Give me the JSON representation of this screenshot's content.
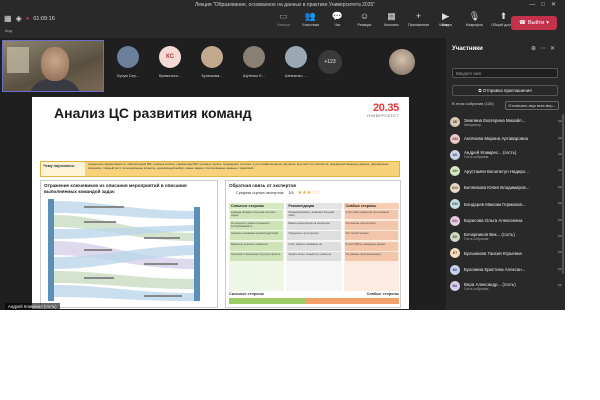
{
  "window": {
    "title": "Лекция \"Образование, основанное на данных в практике Университета 2035\"",
    "controls": [
      "—",
      "□",
      "✕"
    ]
  },
  "toolbar": {
    "exit_label": "Код",
    "timer": "01:09:16",
    "buttons": [
      {
        "icon": "video-icon",
        "glyph": "▭",
        "label": "Камера",
        "dim": true
      },
      {
        "icon": "participants-icon",
        "glyph": "👥",
        "label": "Участники",
        "dim": false
      },
      {
        "icon": "chat-icon",
        "glyph": "💬",
        "label": "Чат",
        "dim": false
      },
      {
        "icon": "reactions-icon",
        "glyph": "☺",
        "label": "Реакции",
        "dim": false
      },
      {
        "icon": "rooms-icon",
        "glyph": "▦",
        "label": "Комнаты",
        "dim": false
      },
      {
        "icon": "apps-icon",
        "glyph": "+",
        "label": "Приложения",
        "dim": false
      },
      {
        "icon": "more-icon",
        "glyph": "···",
        "label": "Еще",
        "dim": false
      }
    ],
    "right_buttons": [
      {
        "icon": "camera-icon",
        "glyph": "▶",
        "label": "Камера"
      },
      {
        "icon": "mic-icon",
        "glyph": "🎙",
        "label": "Микрофон"
      },
      {
        "icon": "share-icon",
        "glyph": "⬆",
        "label": "Общий доступ"
      }
    ],
    "leave_label": "Выйти"
  },
  "tiles": [
    {
      "initials": "",
      "name": "Кучум Сер...",
      "bg": "#6b7f9a",
      "fg": "#fff"
    },
    {
      "initials": "КС",
      "name": "Кривоносо...",
      "bg": "#f4d9d4",
      "fg": "#a1443a"
    },
    {
      "initials": "",
      "name": "Кулешова...",
      "bg": "#c2a88c",
      "fg": "#fff"
    },
    {
      "initials": "",
      "name": "Шутенко Е...",
      "bg": "#8a7f74",
      "fg": "#fff"
    },
    {
      "initials": "",
      "name": "Шевченко ...",
      "bg": "#9aa8b4",
      "fg": "#fff"
    }
  ],
  "more_count": "+123",
  "presenter_tag": "Андрей Клименко (гость)",
  "slide": {
    "title": "Анализ ЦС развития команд",
    "logo_number": "20.35",
    "logo_sub": "УНИВЕРСИТЕТ",
    "goal_label": "Чему научились:",
    "goal_text": "повышение эффективности, лабораторная ВМ, учебные классы, применение ВМ, целевые группы, проведение тестинга, пути онлайн-вещания обучения, круглый стол экспертов, междисциплинарные данные, формальные принципы, главный рост, потенциальные клиенты, однозначный выбор, новые задачи, согласованные данные с практикой",
    "left_panel_title": "Отражение ключевиков из описания мероприятий в описания выполняемых командой задач",
    "right_panel_title": "Обратная связь от экспертов",
    "rating_label": "Средняя оценка экспертов:",
    "rating_value": "3/5",
    "rating_stars": "★★★☆☆",
    "columns": [
      {
        "title": "Сильные стороны",
        "kind": "strong",
        "cards": [
          "Команда обладает большим опытом в сфере",
          "Актуальность данного решения и востребованность",
          "Хорошее понимание целевой аудитории",
          "Маркетинг, высокие показатели",
          "Понятная и прозрачная структура проекта"
        ]
      },
      {
        "title": "Рекомендации",
        "kind": "rec",
        "cards": [
          "Проанализировать, возможно больший охват",
          "Важно концентрация на конкретных",
          "Определить цели проекта",
          "Стоит обратить внимание на",
          "Указать более точный путь развития"
        ]
      },
      {
        "title": "Слабые стороны",
        "kind": "weak",
        "cards": [
          "Отсутствие конкретики при описании",
          "Не понятны цели проекта",
          "Нет четкой позиции",
          "В части ВМ не приведены данные",
          "Не указаны сроки реализации"
        ]
      }
    ],
    "foot_left": "Сильные стороны",
    "foot_right": "Слабые стороны",
    "bar_strong": 0.45
  },
  "panel": {
    "title": "Участники",
    "search_placeholder": "Введите имя",
    "invite_label": "Отправка приглашения",
    "section_label": "В этом собрании (130)",
    "mute_label": "Отключить звук всех мер...",
    "people": [
      {
        "initials": "ЗЕ",
        "name": "Землина Екатерина Михайл...",
        "role": "Инициатор",
        "bg": "#d8c8b6",
        "fg": "#5a4030"
      },
      {
        "initials": "АМ",
        "name": "Аксёнова Марина Артаваровна",
        "role": "",
        "bg": "#e7c9c6",
        "fg": "#8a3f38"
      },
      {
        "initials": "АК",
        "name": "Андрей Климрес... (гость)",
        "role": "Гость собрания",
        "bg": "#c9d3e6",
        "fg": "#34507e"
      },
      {
        "initials": "АН",
        "name": "Арустамян Бесилетун Надиро...",
        "role": "",
        "bg": "#d6e5c7",
        "fg": "#456a2a"
      },
      {
        "initials": "БЮ",
        "name": "Беляевова Юлия Владимиров...",
        "role": "",
        "bg": "#ead9c3",
        "fg": "#7a5a30"
      },
      {
        "initials": "БМ",
        "name": "Бондарев Максим Германов...",
        "role": "",
        "bg": "#c6dde4",
        "fg": "#2f5f6e"
      },
      {
        "initials": "БО",
        "name": "Борисова Ольга Алексеевна",
        "role": "",
        "bg": "#e4cde1",
        "fg": "#6e3a66"
      },
      {
        "initials": "БК",
        "name": "Бочарников Вик... (гость)",
        "role": "Гость собрания",
        "bg": "#cfd8c2",
        "fg": "#4e5d36"
      },
      {
        "initials": "БТ",
        "name": "Булынкова Таисия Юрьевна",
        "role": "",
        "bg": "#f1dcc4",
        "fg": "#7d5228"
      },
      {
        "initials": "БК",
        "name": "Бухонина Кристина Алексан...",
        "role": "",
        "bg": "#c7d4ec",
        "fg": "#30497a"
      },
      {
        "initials": "ВА",
        "name": "Вера Александр... (гость)",
        "role": "Гость собрания",
        "bg": "#d9d2ea",
        "fg": "#4f3f7a"
      }
    ]
  }
}
